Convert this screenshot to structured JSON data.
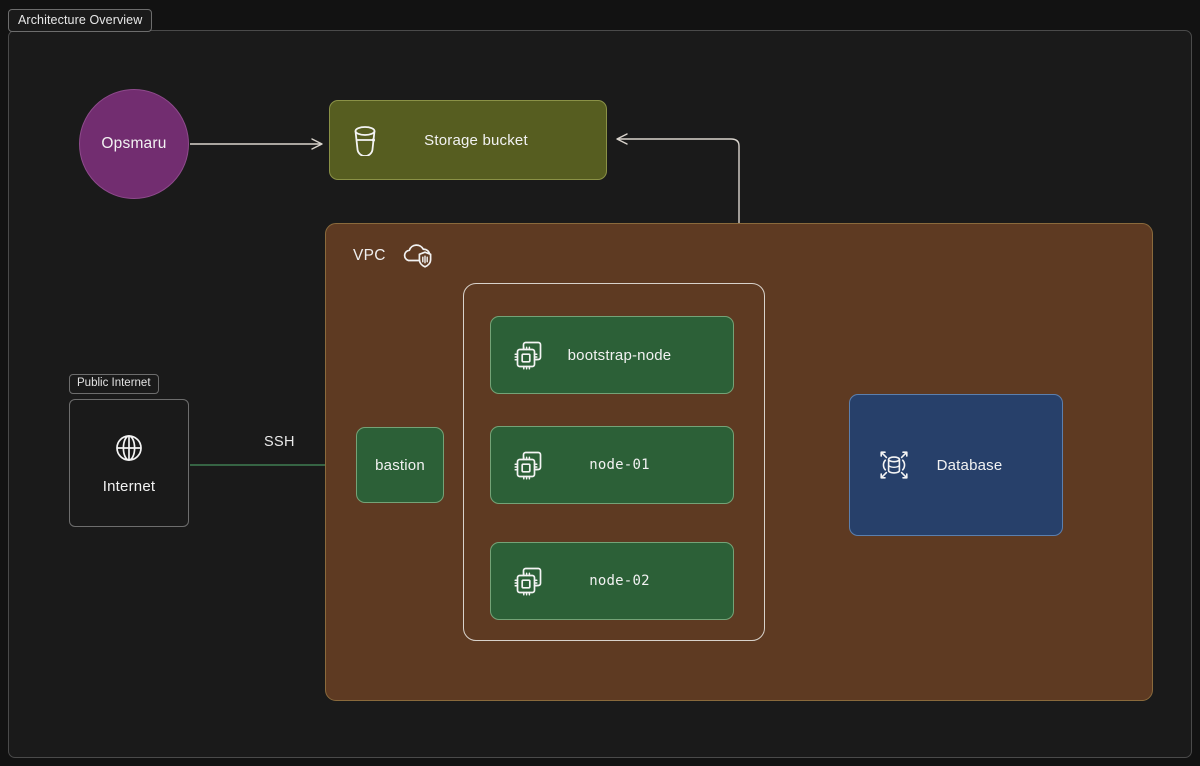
{
  "window": {
    "title": "Architecture Overview"
  },
  "diagram": {
    "type": "architecture-diagram",
    "background_color": "#1a1a1a",
    "groups": [
      {
        "id": "public-internet",
        "label": "Public Internet",
        "style": "outline",
        "color": "#1a1a1a"
      },
      {
        "id": "vpc",
        "label": "VPC",
        "icon": "cloud-shield-icon",
        "color": "#5e3a22"
      },
      {
        "id": "node-pool",
        "label": "",
        "style": "outline",
        "color": "transparent"
      }
    ],
    "nodes": [
      {
        "id": "opsmaru",
        "label": "Opsmaru",
        "shape": "circle",
        "color": "#722d70",
        "icon": ""
      },
      {
        "id": "storage-bucket",
        "label": "Storage bucket",
        "shape": "rounded-rect",
        "color": "#565d20",
        "icon": "bucket-icon"
      },
      {
        "id": "internet",
        "label": "Internet",
        "shape": "rect",
        "color": "#1a1a1a",
        "icon": "globe-icon"
      },
      {
        "id": "bastion",
        "label": "bastion",
        "shape": "rounded-rect",
        "color": "#2c6037",
        "icon": ""
      },
      {
        "id": "bootstrap-node",
        "label": "bootstrap-node",
        "shape": "rounded-rect",
        "color": "#2c6037",
        "icon": "chip-stack-icon"
      },
      {
        "id": "node-01",
        "label": "node-01",
        "shape": "rounded-rect",
        "color": "#2c6037",
        "icon": "chip-stack-icon"
      },
      {
        "id": "node-02",
        "label": "node-02",
        "shape": "rounded-rect",
        "color": "#2c6037",
        "icon": "chip-stack-icon"
      },
      {
        "id": "database",
        "label": "Database",
        "shape": "rounded-rect",
        "color": "#27406a",
        "icon": "scalable-database-icon"
      }
    ],
    "edges": [
      {
        "from": "opsmaru",
        "to": "storage-bucket",
        "label": "",
        "color": "#d9d4cd",
        "arrow": true
      },
      {
        "from": "internet",
        "to": "bastion",
        "label": "SSH",
        "color": "#3f7d52",
        "arrow": true
      },
      {
        "from": "bastion",
        "to": "bootstrap-node",
        "label": "",
        "color": "#d9d4cd",
        "arrow": true
      },
      {
        "from": "bastion",
        "to": "node-01",
        "label": "",
        "color": "#d9d4cd",
        "arrow": true
      },
      {
        "from": "bastion",
        "to": "node-02",
        "label": "",
        "color": "#d9d4cd",
        "arrow": true
      },
      {
        "from": "bootstrap-node",
        "to": "database",
        "label": "",
        "color": "#d9d4cd",
        "arrow": true
      },
      {
        "from": "node-01",
        "to": "database",
        "label": "",
        "color": "#d9d4cd",
        "arrow": true
      },
      {
        "from": "node-02",
        "to": "database",
        "label": "",
        "color": "#d9d4cd",
        "arrow": true
      },
      {
        "from": "node-pool",
        "to": "storage-bucket",
        "label": "",
        "color": "#d9d4cd",
        "arrow": true
      }
    ],
    "edge_labels": {
      "ssh": "SSH"
    }
  }
}
